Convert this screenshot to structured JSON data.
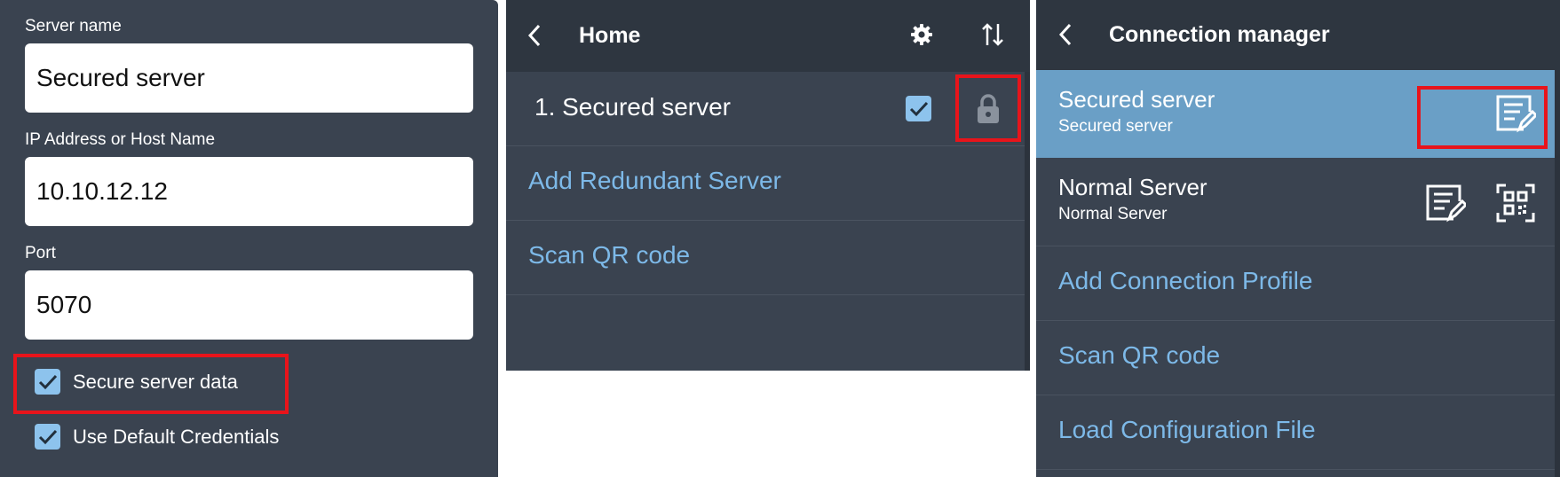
{
  "server_form": {
    "server_name_label": "Server name",
    "server_name_value": "Secured server",
    "ip_label": "IP Address or Host Name",
    "ip_value": "10.10.12.12",
    "port_label": "Port",
    "port_value": "5070",
    "secure_data_label": "Secure server data",
    "secure_data_checked": true,
    "default_credentials_label": "Use Default Credentials",
    "default_credentials_checked": true
  },
  "home": {
    "title": "Home",
    "server_item": "1. Secured server",
    "server_checked": true,
    "add_redundant": "Add Redundant Server",
    "scan_qr": "Scan QR code"
  },
  "connection_manager": {
    "title": "Connection manager",
    "profiles": [
      {
        "name": "Secured server",
        "subtitle": "Secured server",
        "selected": true
      },
      {
        "name": "Normal Server",
        "subtitle": "Normal Server",
        "selected": false
      }
    ],
    "add_profile": "Add Connection Profile",
    "scan_qr": "Scan QR code",
    "load_config": "Load Configuration File"
  },
  "colors": {
    "panel_bg": "#3a4350",
    "topbar_bg": "#2e3640",
    "selected_row": "#6a9fc6",
    "link": "#7db9e8",
    "checkbox": "#8dc3ed",
    "highlight": "#e8141b"
  }
}
